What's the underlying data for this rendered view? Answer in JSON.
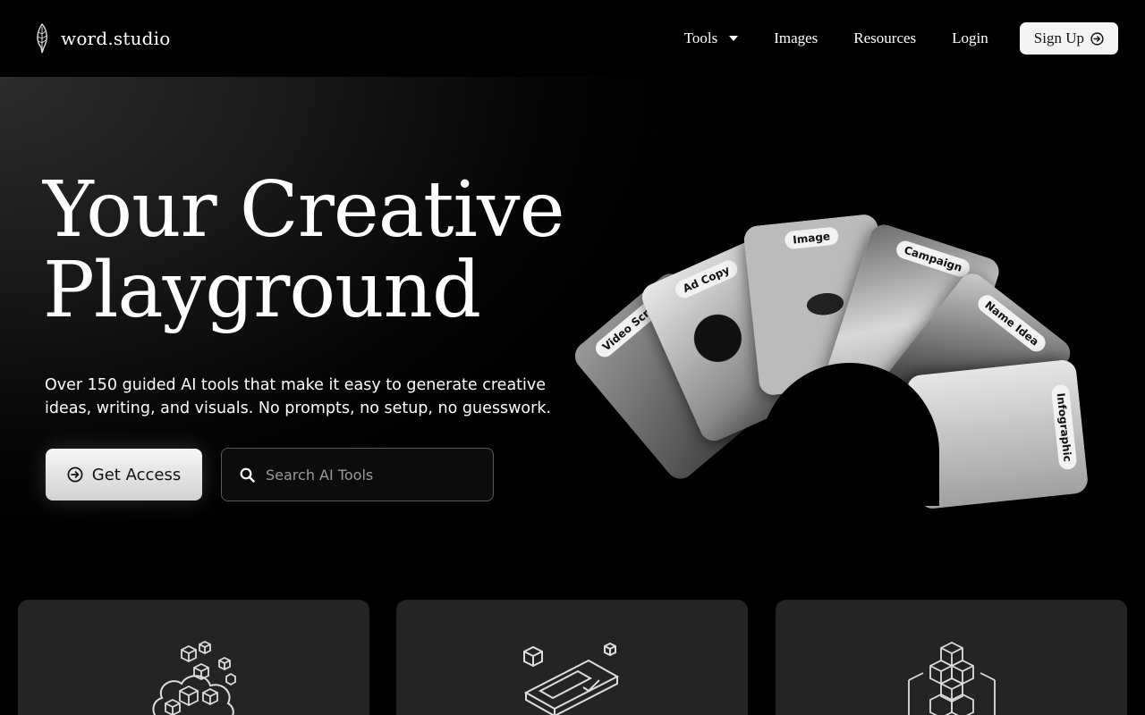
{
  "brand": {
    "name": "word.studio",
    "logo_icon": "feather-icon"
  },
  "nav": {
    "items": [
      {
        "label": "Tools",
        "has_dropdown": true
      },
      {
        "label": "Images"
      },
      {
        "label": "Resources"
      },
      {
        "label": "Login"
      }
    ],
    "signup_label": "Sign Up"
  },
  "hero": {
    "title_line1": "Your Creative",
    "title_line2": "Playground",
    "subtitle": "Over 150 guided AI tools that make it easy to generate creative ideas, writing, and visuals. No prompts, no setup, no guesswork.",
    "cta_label": "Get Access",
    "search_placeholder": "Search AI Tools"
  },
  "cards": [
    {
      "label": "Video Script"
    },
    {
      "label": "Ad Copy"
    },
    {
      "label": "Image"
    },
    {
      "label": "Campaign"
    },
    {
      "label": "Name Idea"
    },
    {
      "label": "Infographic"
    }
  ],
  "features": [
    {
      "icon": "cloud-cubes-icon"
    },
    {
      "icon": "ticket-check-icon"
    },
    {
      "icon": "cube-stack-icon"
    }
  ],
  "colors": {
    "background": "#000000",
    "card": "#242424",
    "accent": "#f4f4f4"
  }
}
